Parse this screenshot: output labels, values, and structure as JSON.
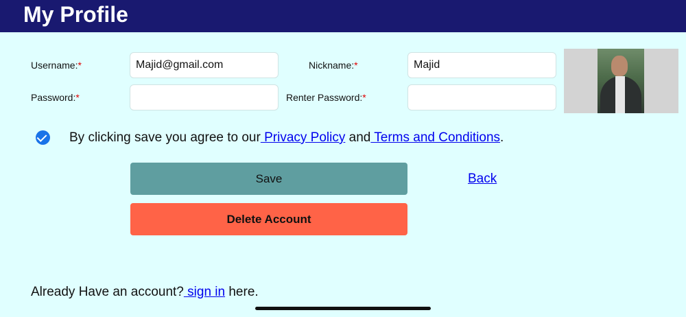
{
  "header": {
    "title": "My Profile"
  },
  "form": {
    "username": {
      "label": "Username:",
      "required_mark": "*",
      "value": "Majid@gmail.com"
    },
    "nickname": {
      "label": "Nickname:",
      "required_mark": "*",
      "value": "Majid"
    },
    "password": {
      "label": "Password:",
      "required_mark": "*",
      "value": ""
    },
    "renter_password": {
      "label": "Renter Password:",
      "required_mark": "*",
      "value": ""
    }
  },
  "agreement": {
    "checked": true,
    "text_before": "By clicking save you agree to our",
    "privacy_link": " Privacy Policy",
    "text_middle": " and",
    "terms_link": " Terms and Conditions",
    "text_after": "."
  },
  "actions": {
    "save_label": "Save",
    "delete_label": "Delete Account",
    "back_label": "Back"
  },
  "footer": {
    "text_before": "Already Have an account?",
    "signin_link": " sign in",
    "text_after": " here."
  },
  "colors": {
    "header_bg": "#191970",
    "page_bg": "#e0ffff",
    "save_bg": "#5f9ea0",
    "delete_bg": "#ff6347",
    "link": "#0000ee",
    "checkbox": "#1a73e8",
    "required": "#e00000"
  },
  "icons": {
    "checkbox": "checkmark-circle-icon"
  }
}
